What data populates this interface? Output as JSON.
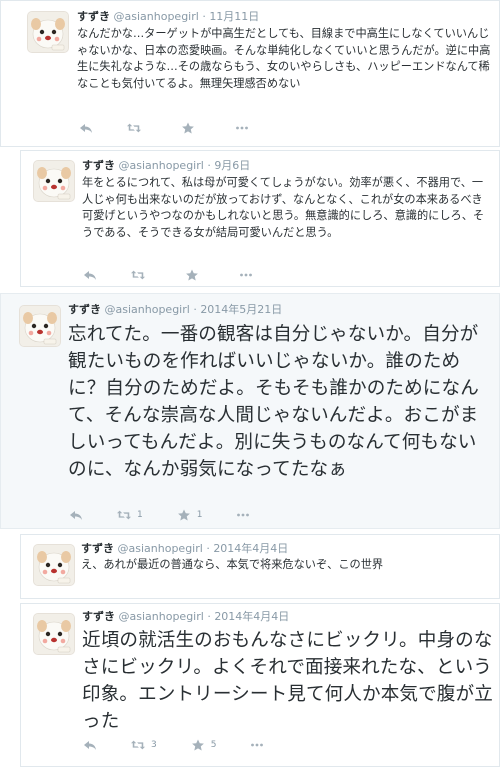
{
  "tweets": [
    {
      "name": "すずき",
      "handle": "@asianhopegirl",
      "date": "11月11日",
      "text": "なんだかな…ターゲットが中高生だとしても、目線まで中高生にしなくていいんじゃないかな、日本の恋愛映画。そんな単純化しなくていいと思うんだが。逆に中高生に失礼なような…その歳ならもう、女のいやらしさも、ハッピーエンドなんて稀なことも気付いてるよ。無理矢理感否めない",
      "retweets": "",
      "favorites": ""
    },
    {
      "name": "すずき",
      "handle": "@asianhopegirl",
      "date": "9月6日",
      "text": "年をとるにつれて、私は母が可愛くてしょうがない。効率が悪く、不器用で、一人じゃ何も出来ないのだが放っておけず、なんとなく、これが女の本来あるべき可愛げというやつなのかもしれないと思う。無意識的にしろ、意識的にしろ、そうである、そうできる女が結局可愛いんだと思う。",
      "retweets": "",
      "favorites": ""
    },
    {
      "name": "すずき",
      "handle": "@asianhopegirl",
      "date": "2014年5月21日",
      "text": "忘れてた。一番の観客は自分じゃないか。自分が観たいものを作ればいいじゃないか。誰のために？自分のためだよ。そもそも誰かのためになんて、そんな崇高な人間じゃないんだよ。おこがましいってもんだよ。別に失うものなんて何もないのに、なんか弱気になってたなぁ",
      "retweets": "1",
      "favorites": "1"
    },
    {
      "name": "すずき",
      "handle": "@asianhopegirl",
      "date": "2014年4月4日",
      "text": "え、あれが最近の普通なら、本気で将来危ないぞ、この世界",
      "retweets": "",
      "favorites": ""
    },
    {
      "name": "すずき",
      "handle": "@asianhopegirl",
      "date": "2014年4月4日",
      "text": "近頃の就活生のおもんなさにビックリ。中身のなさにビックリ。よくそれで面接来れたな、という印象。エントリーシート見て何人か本気で腹が立った",
      "retweets": "3",
      "favorites": "5"
    }
  ],
  "icons": [
    "reply-icon",
    "retweet-icon",
    "favorite-icon",
    "more-icon"
  ],
  "colors": {
    "name": "#292f33",
    "meta": "#8899a6",
    "icon": "#a5b1ba",
    "border": "#e1e8ed",
    "card_gray": "#f5f8fa"
  }
}
